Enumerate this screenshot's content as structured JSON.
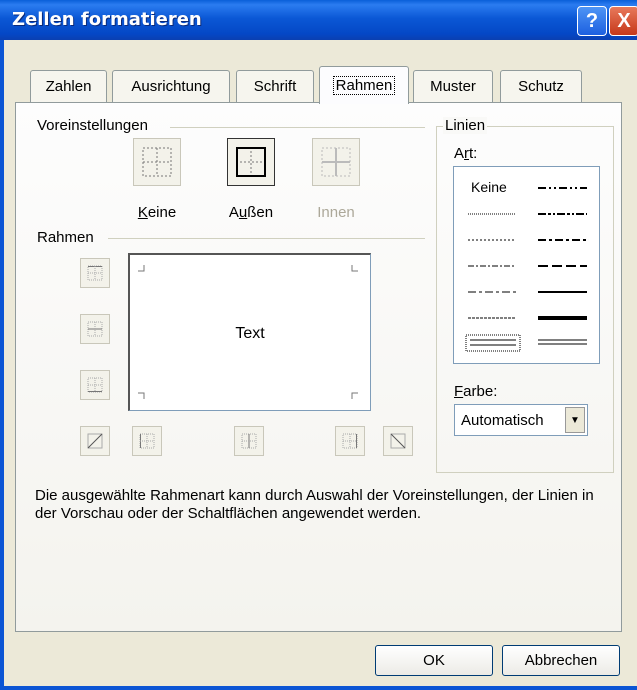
{
  "window": {
    "title": "Zellen formatieren"
  },
  "titlebar_buttons": {
    "help": "?",
    "close": "X"
  },
  "tabs": [
    {
      "label": "Zahlen"
    },
    {
      "label": "Ausrichtung"
    },
    {
      "label": "Schrift"
    },
    {
      "label": "Rahmen",
      "active": true
    },
    {
      "label": "Muster"
    },
    {
      "label": "Schutz"
    }
  ],
  "presets": {
    "group_label": "Voreinstellungen",
    "items": [
      {
        "label": "Keine",
        "underline": "K",
        "enabled": true
      },
      {
        "label": "Außen",
        "underline": "u",
        "enabled": true
      },
      {
        "label": "Innen",
        "enabled": false
      }
    ]
  },
  "border": {
    "group_label": "Rahmen",
    "preview_text": "Text"
  },
  "lines": {
    "group_label": "Linien",
    "style_label": "Art:",
    "style_none": "Keine",
    "color_label": "Farbe:",
    "color_value": "Automatisch"
  },
  "description": "Die ausgewählte Rahmenart kann durch Auswahl der Voreinstellungen, der Linien in der Vorschau oder der Schaltflächen angewendet werden.",
  "buttons": {
    "ok": "OK",
    "cancel": "Abbrechen"
  }
}
